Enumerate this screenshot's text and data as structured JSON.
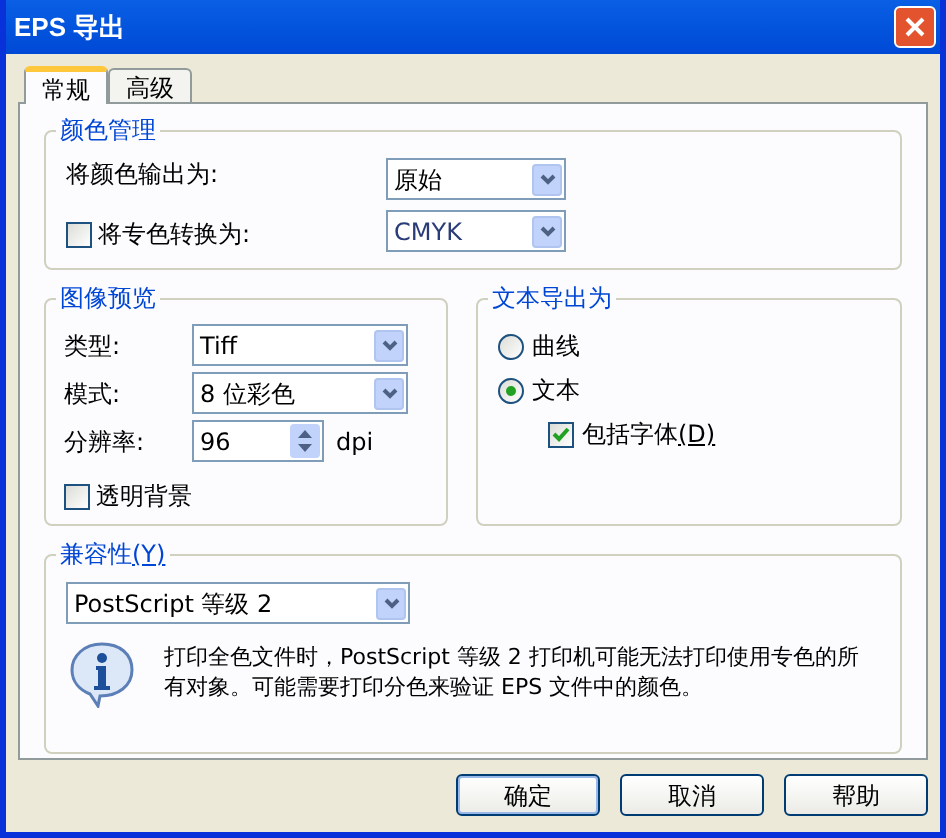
{
  "window": {
    "title": "EPS 导出"
  },
  "tabs": [
    {
      "label": "常规",
      "selected": true
    },
    {
      "label": "高级",
      "selected": false
    }
  ],
  "color_management": {
    "title": "颜色管理",
    "output_label": "将颜色输出为:",
    "output_value": "原始",
    "convert_spot": {
      "label": "将专色转换为:",
      "checked": false,
      "value": "CMYK"
    }
  },
  "image_preview": {
    "title": "图像预览",
    "type_label": "类型:",
    "type_value": "Tiff",
    "mode_label": "模式:",
    "mode_value": "8 位彩色",
    "resolution_label": "分辨率:",
    "resolution_value": "96",
    "resolution_unit": "dpi",
    "transparent": {
      "label": "透明背景",
      "checked": false
    }
  },
  "text_export": {
    "title": "文本导出为",
    "options": [
      {
        "label": "曲线",
        "selected": false
      },
      {
        "label": "文本",
        "selected": true
      }
    ],
    "include_fonts": {
      "label": "包括字体",
      "hotkey": "(D)",
      "checked": true
    }
  },
  "compatibility": {
    "title": "兼容性",
    "hotkey": "(Y)",
    "value": "PostScript 等级 2",
    "message": "打印全色文件时，PostScript 等级 2 打印机可能无法打印使用专色的所有对象。可能需要打印分色来验证 EPS 文件中的颜色。"
  },
  "buttons": [
    "确定",
    "取消",
    "帮助"
  ]
}
